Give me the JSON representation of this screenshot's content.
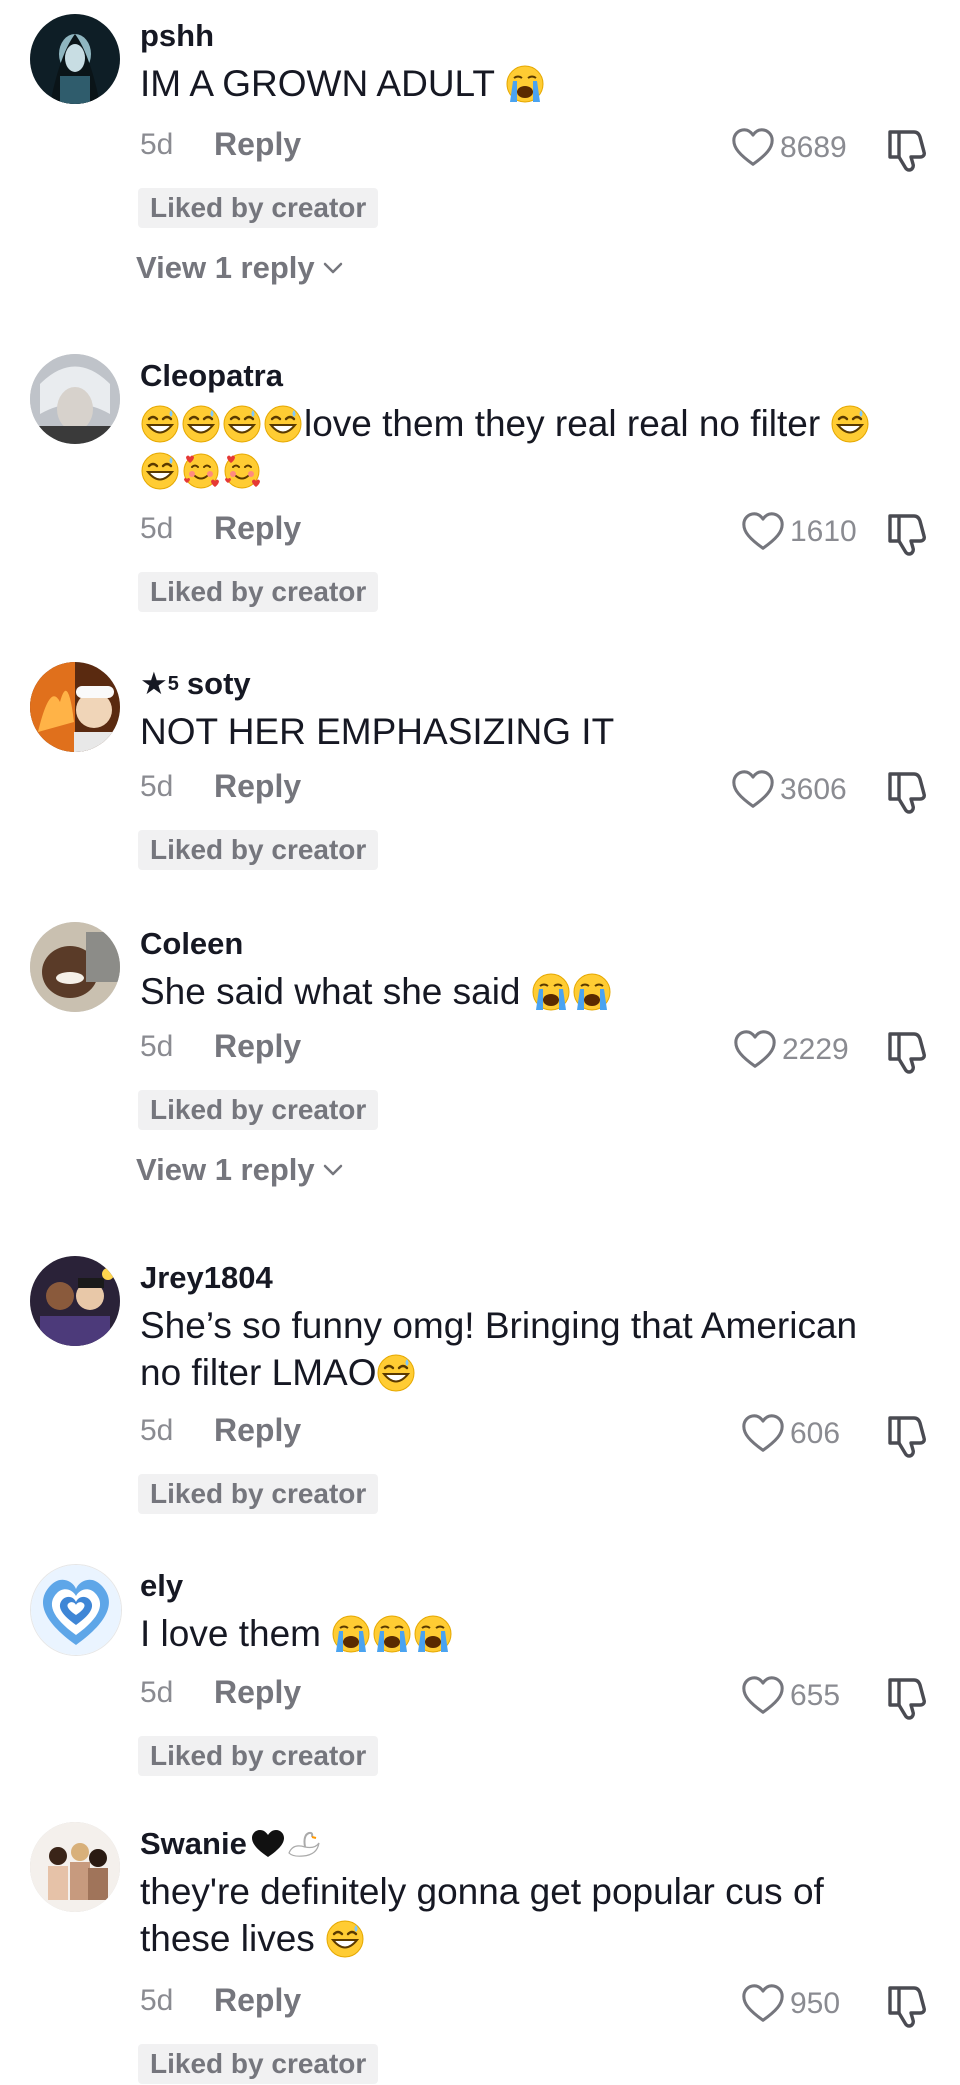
{
  "comments": [
    {
      "username": "pshh",
      "text": "IM A GROWN ADULT",
      "emojis_inline": [
        "crying"
      ],
      "time": "5d",
      "reply_label": "Reply",
      "likes": "8689",
      "badge": "Liked by creator",
      "view_replies": "View 1 reply"
    },
    {
      "username": "Cleopatra",
      "text": "love them they real real no filter",
      "emojis_before": [
        "grin-sweat",
        "grin-sweat",
        "grin-sweat",
        "grin-sweat"
      ],
      "emojis_after": [
        "grin-sweat"
      ],
      "emojis_line2": [
        "grin-sweat",
        "smiling-hearts",
        "smiling-hearts"
      ],
      "time": "5d",
      "reply_label": "Reply",
      "likes": "1610",
      "badge": "Liked by creator"
    },
    {
      "username_star": "★",
      "username_sup": "5",
      "username": "soty",
      "text": "NOT HER EMPHASIZING IT",
      "time": "5d",
      "reply_label": "Reply",
      "likes": "3606",
      "badge": "Liked by creator"
    },
    {
      "username": "Coleen",
      "text": "She said what she said",
      "emojis_inline": [
        "crying",
        "crying"
      ],
      "time": "5d",
      "reply_label": "Reply",
      "likes": "2229",
      "badge": "Liked by creator",
      "view_replies": "View 1 reply"
    },
    {
      "username": "Jrey1804",
      "text_line1": "She’s so funny omg! Bringing that American",
      "text_line2": "no filter LMAO",
      "emojis_inline": [
        "grin-sweat"
      ],
      "time": "5d",
      "reply_label": "Reply",
      "likes": "606",
      "badge": "Liked by creator"
    },
    {
      "username": "ely",
      "text": "I love them",
      "emojis_inline": [
        "crying",
        "crying",
        "crying"
      ],
      "time": "5d",
      "reply_label": "Reply",
      "likes": "655",
      "badge": "Liked by creator"
    },
    {
      "username": "Swanie",
      "username_emojis": [
        "black-heart",
        "swan"
      ],
      "text_line1": "they're definitely gonna get popular cus of",
      "text_line2": "these lives",
      "emojis_inline": [
        "grin-sweat"
      ],
      "time": "5d",
      "reply_label": "Reply",
      "likes": "950",
      "badge": "Liked by creator"
    }
  ],
  "icons": {
    "like": "heart-outline-icon",
    "dislike": "thumbs-down-icon",
    "expand": "chevron-down-icon"
  },
  "colors": {
    "text_primary": "#161823",
    "text_secondary": "#8a8b91",
    "badge_bg": "#f1f1f2"
  }
}
